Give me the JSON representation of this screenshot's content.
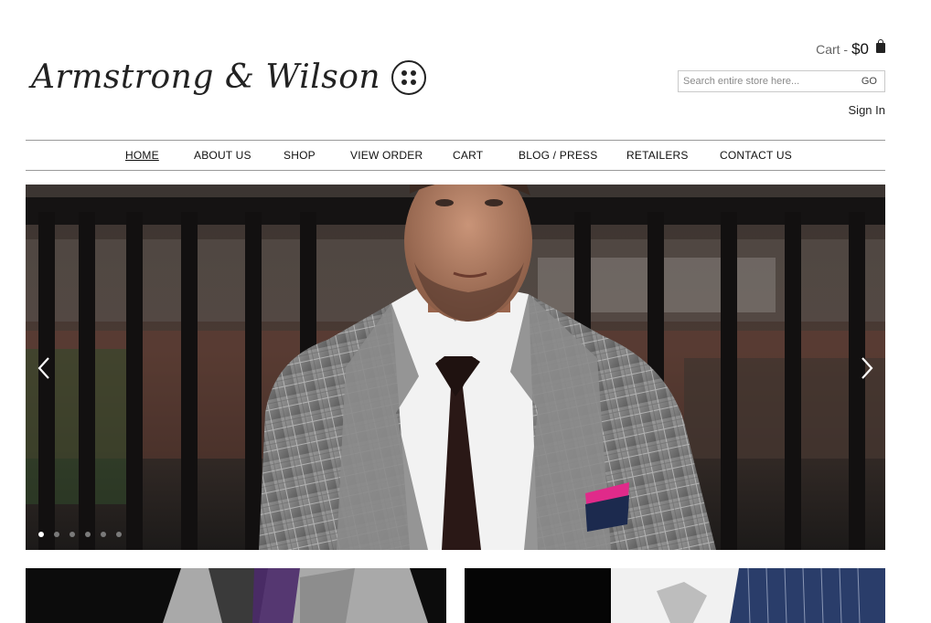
{
  "brand": {
    "name": "Armstrong & Wilson"
  },
  "header": {
    "cart_label": "Cart -",
    "cart_total": "$0",
    "search_placeholder": "Search entire store here...",
    "search_button": "GO",
    "sign_in": "Sign In"
  },
  "nav": {
    "items": [
      {
        "label": "HOME",
        "active": true
      },
      {
        "label": "ABOUT US"
      },
      {
        "label": "SHOP"
      },
      {
        "label": "VIEW ORDER"
      },
      {
        "label": "CART"
      },
      {
        "label": "BLOG / PRESS"
      },
      {
        "label": "RETAILERS"
      },
      {
        "label": "CONTACT US"
      }
    ]
  },
  "slider": {
    "slide_count": 6,
    "active_slide": 1,
    "prev_icon": "chevron-left-icon",
    "next_icon": "chevron-right-icon"
  },
  "colors": {
    "text": "#222222",
    "nav_border": "#9a9a9a",
    "dot_active": "#ffffff",
    "dot_inactive": "#7a7a7a"
  }
}
